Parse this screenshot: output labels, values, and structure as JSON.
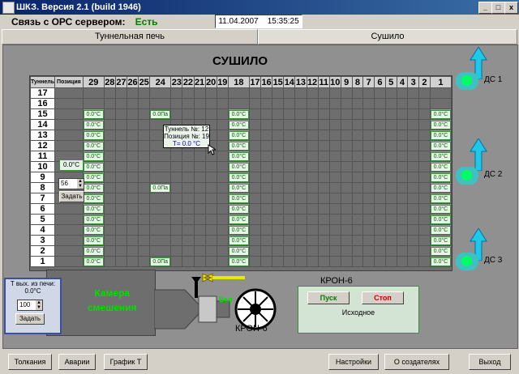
{
  "window": {
    "title": "ШКЗ. Версия 2.1 (build 1946)",
    "minimize": "_",
    "maximize": "□",
    "close": "x"
  },
  "status": {
    "opc_label": "Связь с ОРС сервером:",
    "opc_value": "Есть",
    "date": "11.04.2007",
    "time": "15:35:25"
  },
  "tabs": [
    {
      "label": "Туннельная печь"
    },
    {
      "label": "Сушило"
    }
  ],
  "dryer": {
    "title": "СУШИЛО",
    "col_header_tunnel": "Туннель",
    "col_header_position": "Позиция",
    "positions": [
      "29",
      "28",
      "27",
      "26",
      "25",
      "24",
      "23",
      "22",
      "21",
      "20",
      "19",
      "18",
      "17",
      "16",
      "15",
      "14",
      "13",
      "12",
      "11",
      "10",
      "9",
      "8",
      "7",
      "6",
      "5",
      "4",
      "3",
      "2",
      "1"
    ],
    "tunnels": [
      "17",
      "16",
      "15",
      "14",
      "13",
      "12",
      "11",
      "10",
      "9",
      "8",
      "7",
      "6",
      "5",
      "4",
      "3",
      "2",
      "1"
    ],
    "temp_label": "0.0°C",
    "pressure_label": "0.0Па",
    "left_temp": "0.0°C",
    "spin_value": "56",
    "set_button": "Задать",
    "tooltip": {
      "line1": "Туннель №: 12",
      "line2": "Позиция №: 19",
      "line3": "T= 0.0 °C"
    }
  },
  "fans": {
    "ds1": "ДС 1",
    "ds2": "ДС 2",
    "ds3": "ДС 3"
  },
  "chamber": {
    "label1": "Камера",
    "label2": "смешения",
    "valve_label": "Вкл",
    "kron_caption": "КРОН-6"
  },
  "temp_out": {
    "label": "T вых. из печи:",
    "value": "0.0°C",
    "spin_value": "100",
    "set_button": "Задать"
  },
  "kron_panel": {
    "title": "КРОН-6",
    "start": "Пуск",
    "stop": "Стоп",
    "status": "Исходное"
  },
  "bottom": {
    "btn1": "Толкания",
    "btn2": "Аварии",
    "btn3": "График Т",
    "btn4": "Настройки",
    "btn5": "О создателях",
    "btn6": "Выход"
  }
}
